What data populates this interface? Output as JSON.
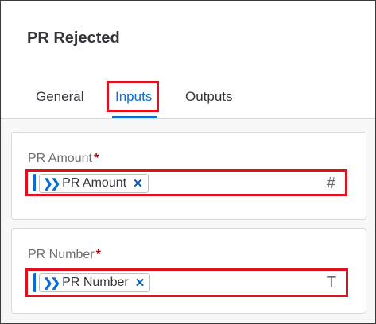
{
  "header": {
    "title": "PR Rejected",
    "tabs": [
      "General",
      "Inputs",
      "Outputs"
    ]
  },
  "fields": [
    {
      "label": "PR Amount",
      "required_marker": "*",
      "token": "PR Amount",
      "token_icon": "chevron-double-right-icon",
      "remove_icon": "close-icon",
      "type_symbol": "#",
      "type_icon": "number-type-icon"
    },
    {
      "label": "PR Number",
      "required_marker": "*",
      "token": "PR Number",
      "token_icon": "chevron-double-right-icon",
      "remove_icon": "close-icon",
      "type_symbol": "T",
      "type_icon": "text-type-icon"
    }
  ],
  "colors": {
    "accent": "#0a6ed1",
    "highlight": "#e0101f",
    "required": "#bb0000"
  }
}
